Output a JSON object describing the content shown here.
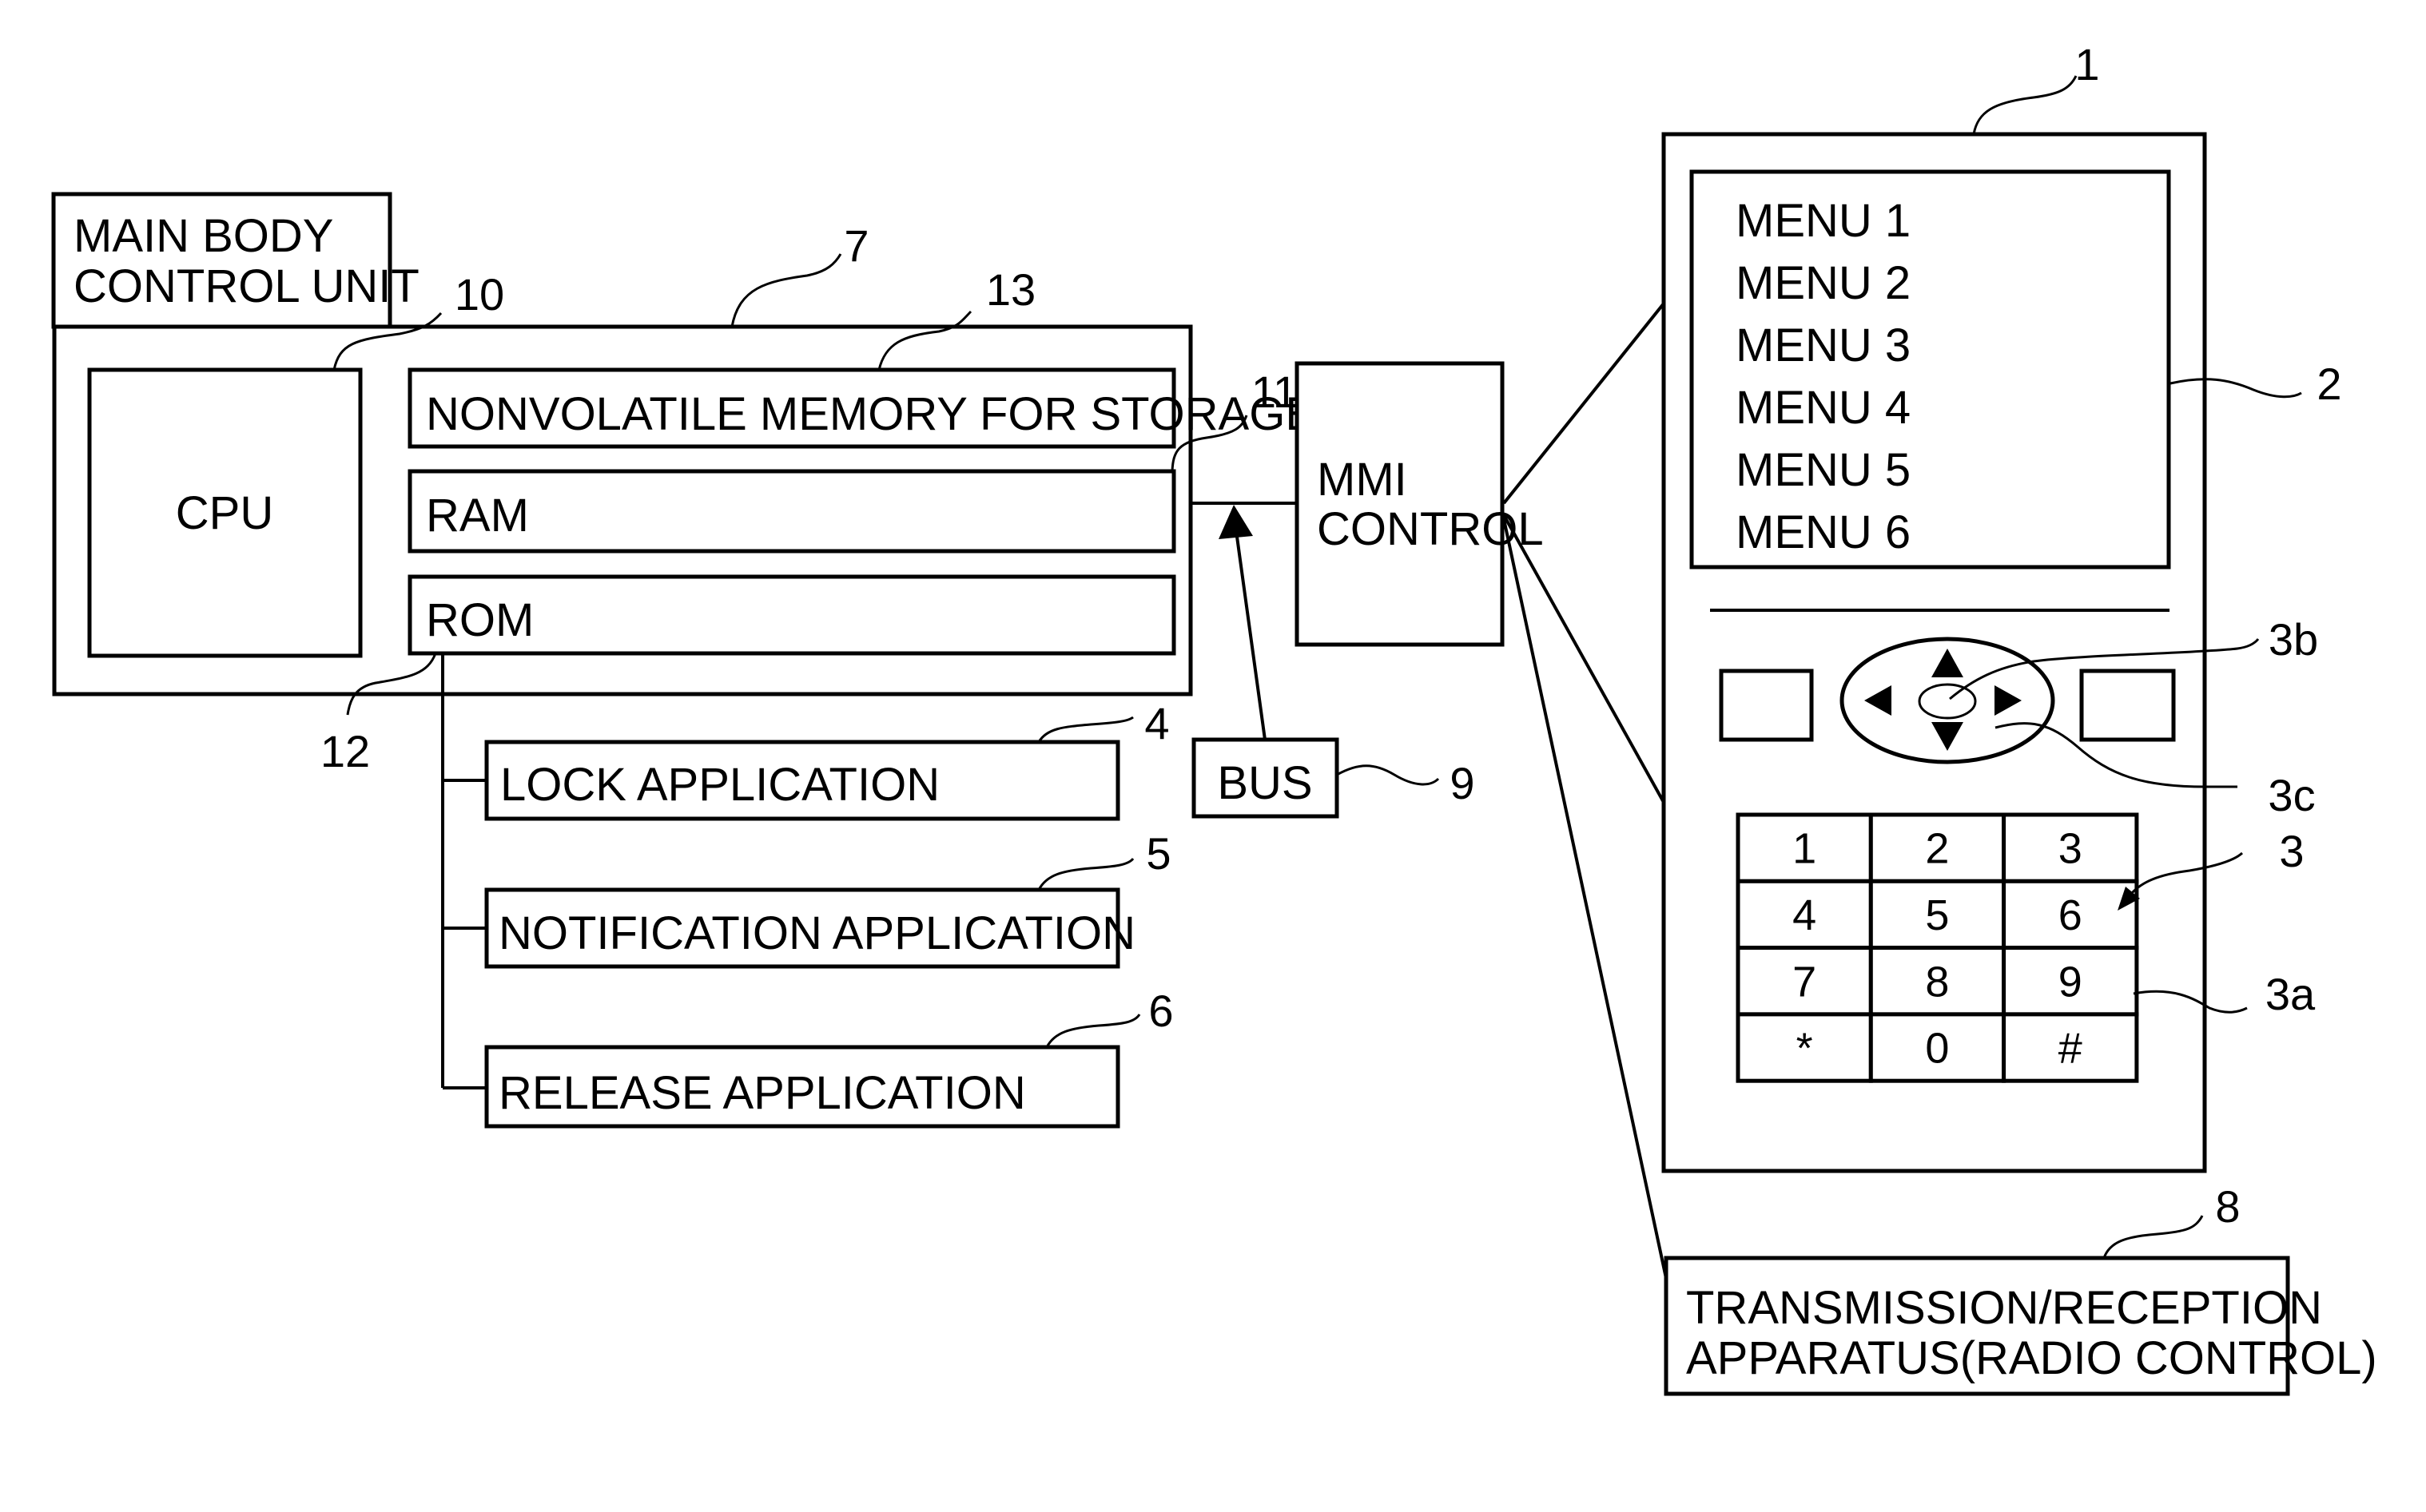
{
  "figure": {
    "main_body_label": [
      "MAIN BODY",
      "CONTROL UNIT"
    ],
    "cpu_label": "CPU",
    "memory": {
      "nonvolatile": "NONVOLATILE MEMORY FOR STORAGE",
      "ram": "RAM",
      "rom": "ROM"
    },
    "applications": [
      {
        "label": "LOCK APPLICATION",
        "ref": "4"
      },
      {
        "label": "NOTIFICATION APPLICATION",
        "ref": "5"
      },
      {
        "label": "RELEASE APPLICATION",
        "ref": "6"
      }
    ],
    "mmi_label": [
      "MMI",
      "CONTROL"
    ],
    "bus_label": "BUS",
    "transceiver_label": [
      "TRANSMISSION/RECEPTION",
      "APPARATUS(RADIO CONTROL)"
    ],
    "phone": {
      "menu_items": [
        "MENU 1",
        "MENU 2",
        "MENU 3",
        "MENU 4",
        "MENU 5",
        "MENU 6"
      ],
      "keypad": [
        [
          "1",
          "2",
          "3"
        ],
        [
          "4",
          "5",
          "6"
        ],
        [
          "7",
          "8",
          "9"
        ],
        [
          "*",
          "0",
          "#"
        ]
      ]
    },
    "refs": {
      "phone": "1",
      "display": "2",
      "keys": "3",
      "key_button": "3a",
      "center_button": "3b",
      "direction_pad": "3c",
      "main_control": "7",
      "transceiver": "8",
      "bus": "9",
      "cpu": "10",
      "ram": "11",
      "rom": "12",
      "nonvolatile": "13"
    }
  }
}
